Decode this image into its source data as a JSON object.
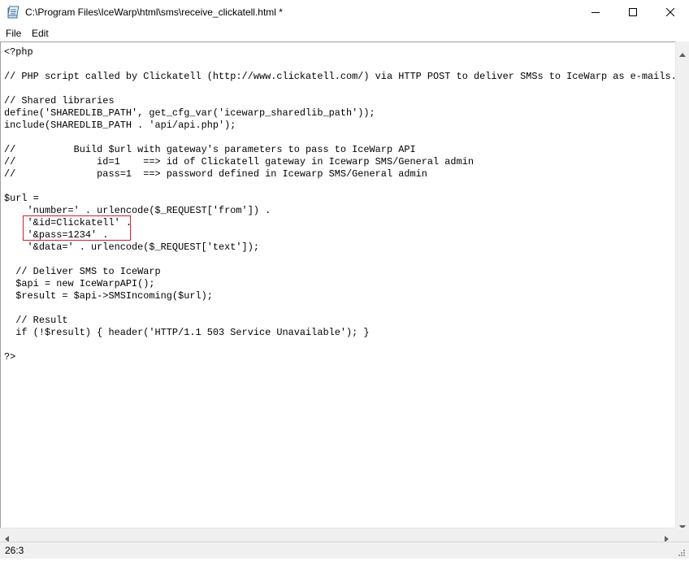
{
  "window": {
    "title": "C:\\Program Files\\IceWarp\\html\\sms\\receive_clickatell.html *",
    "app_icon": "notepad-icon",
    "controls": [
      "minimize-icon",
      "maximize-icon",
      "close-icon"
    ]
  },
  "menu": {
    "items": [
      {
        "label": "File"
      },
      {
        "label": "Edit"
      }
    ]
  },
  "editor": {
    "lines": [
      "<?php",
      "",
      "// PHP script called by Clickatell (http://www.clickatell.com/) via HTTP POST to deliver SMSs to IceWarp as e-mails.",
      "",
      "// Shared libraries",
      "define('SHAREDLIB_PATH', get_cfg_var('icewarp_sharedlib_path'));",
      "include(SHAREDLIB_PATH . 'api/api.php');",
      "",
      "//          Build $url with gateway's parameters to pass to IceWarp API",
      "//              id=1    ==> id of Clickatell gateway in Icewarp SMS/General admin",
      "//              pass=1  ==> password defined in Icewarp SMS/General admin",
      "",
      "$url =",
      "    'number=' . urlencode($_REQUEST['from']) .",
      "    '&id=Clickatell' .",
      "    '&pass=1234' .",
      "    '&data=' . urlencode($_REQUEST['text']);",
      "",
      "  // Deliver SMS to IceWarp",
      "  $api = new IceWarpAPI();",
      "  $result = $api->SMSIncoming($url);",
      "",
      "  // Result",
      "  if (!$result) { header('HTTP/1.1 503 Service Unavailable'); }",
      "",
      "?>"
    ]
  },
  "statusbar": {
    "position": "26:3"
  },
  "colors": {
    "highlight_border": "#d0202a"
  }
}
